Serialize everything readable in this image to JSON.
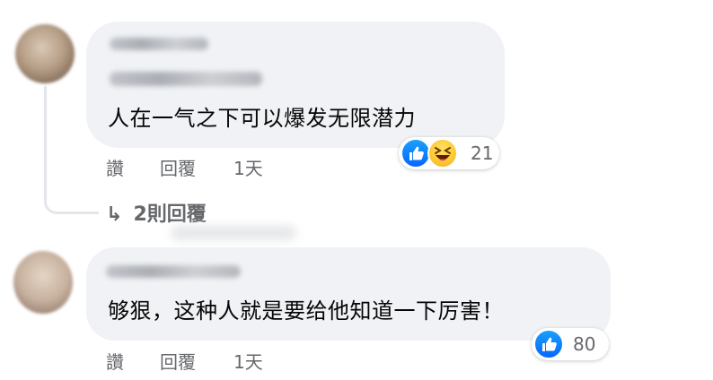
{
  "comments": [
    {
      "text": "人在一气之下可以爆发无限潜力",
      "actions": {
        "like": "讚",
        "reply": "回覆",
        "time": "1天"
      },
      "reactions": {
        "icons": [
          "like-icon",
          "haha-icon"
        ],
        "count": "21"
      },
      "replies_label": "2則回覆"
    },
    {
      "text": "够狠，这种人就是要给他知道一下厉害！",
      "actions": {
        "like": "讚",
        "reply": "回覆",
        "time": "1天"
      },
      "reactions": {
        "icons": [
          "like-icon"
        ],
        "count": "80"
      }
    }
  ],
  "colors": {
    "bubble": "#f0f2f5",
    "secondary_text": "#65676b",
    "like_blue": "#0866ff",
    "haha_yellow": "#fcc834"
  }
}
